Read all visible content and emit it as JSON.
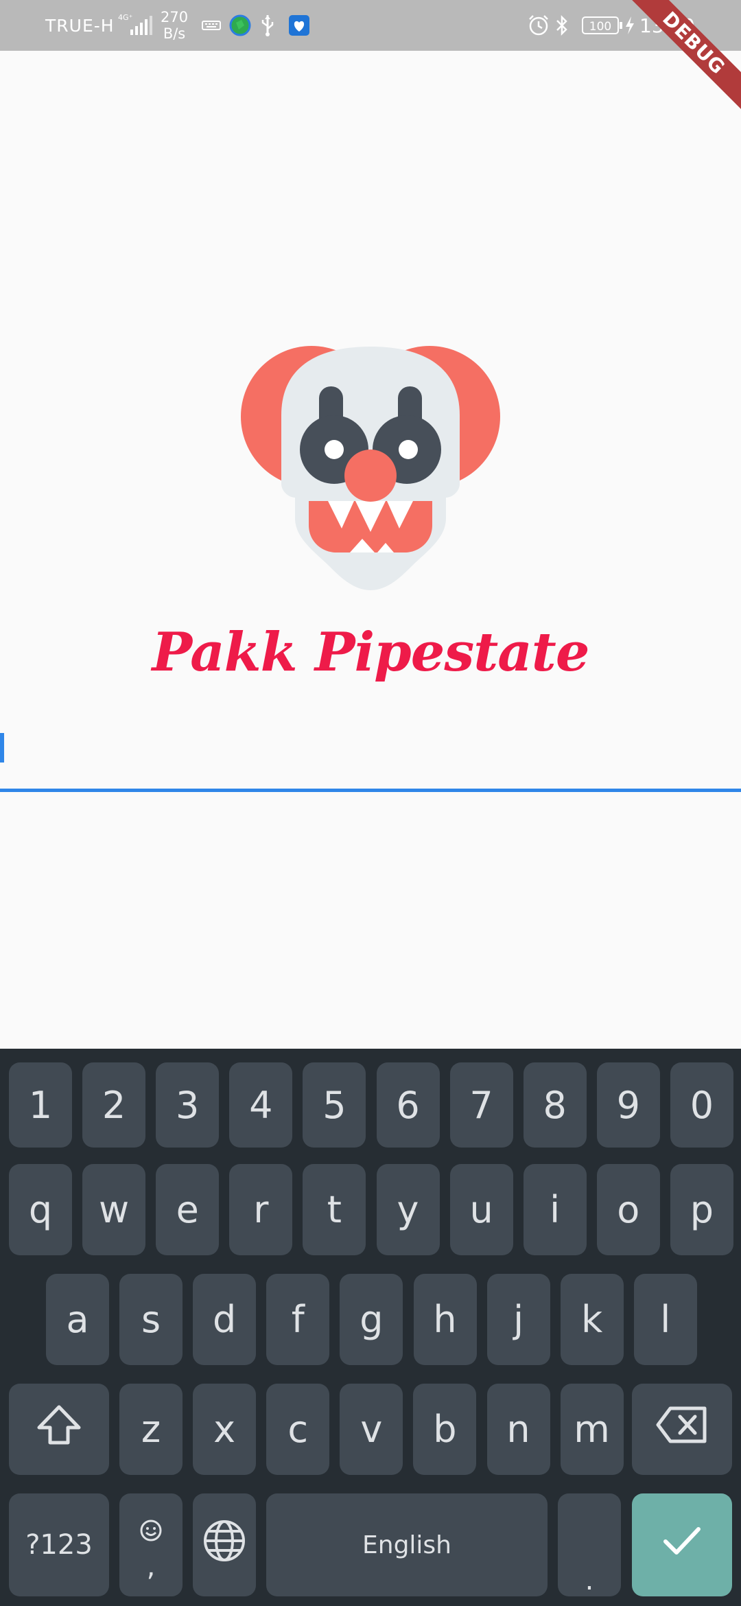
{
  "status_bar": {
    "carrier": "TRUE-H",
    "network_type": "4G⁺",
    "speed_value": "270",
    "speed_unit": "B/s",
    "battery": "100",
    "time": "13:40"
  },
  "debug_banner": "DEBUG",
  "app": {
    "title": "Pakk Pipestate",
    "logo_colors": {
      "hair": "#f56f63",
      "face": "#e6ebee",
      "eyes": "#474f59",
      "nose": "#f56f63",
      "mouth": "#f56f63"
    },
    "accent_color": "#2f86e8"
  },
  "keyboard": {
    "number_row": [
      "1",
      "2",
      "3",
      "4",
      "5",
      "6",
      "7",
      "8",
      "9",
      "0"
    ],
    "row1": [
      "q",
      "w",
      "e",
      "r",
      "t",
      "y",
      "u",
      "i",
      "o",
      "p"
    ],
    "row2": [
      "a",
      "s",
      "d",
      "f",
      "g",
      "h",
      "j",
      "k",
      "l"
    ],
    "row3": [
      "z",
      "x",
      "c",
      "v",
      "b",
      "n",
      "m"
    ],
    "symbols_label": "?123",
    "comma_label": ",",
    "space_label": "English",
    "period_label": ".",
    "icons": {
      "shift": "shift-icon",
      "backspace": "backspace-icon",
      "emoji": "emoji-icon",
      "language": "globe-icon",
      "enter": "checkmark-icon"
    },
    "enter_color": "#6eb0a8"
  }
}
